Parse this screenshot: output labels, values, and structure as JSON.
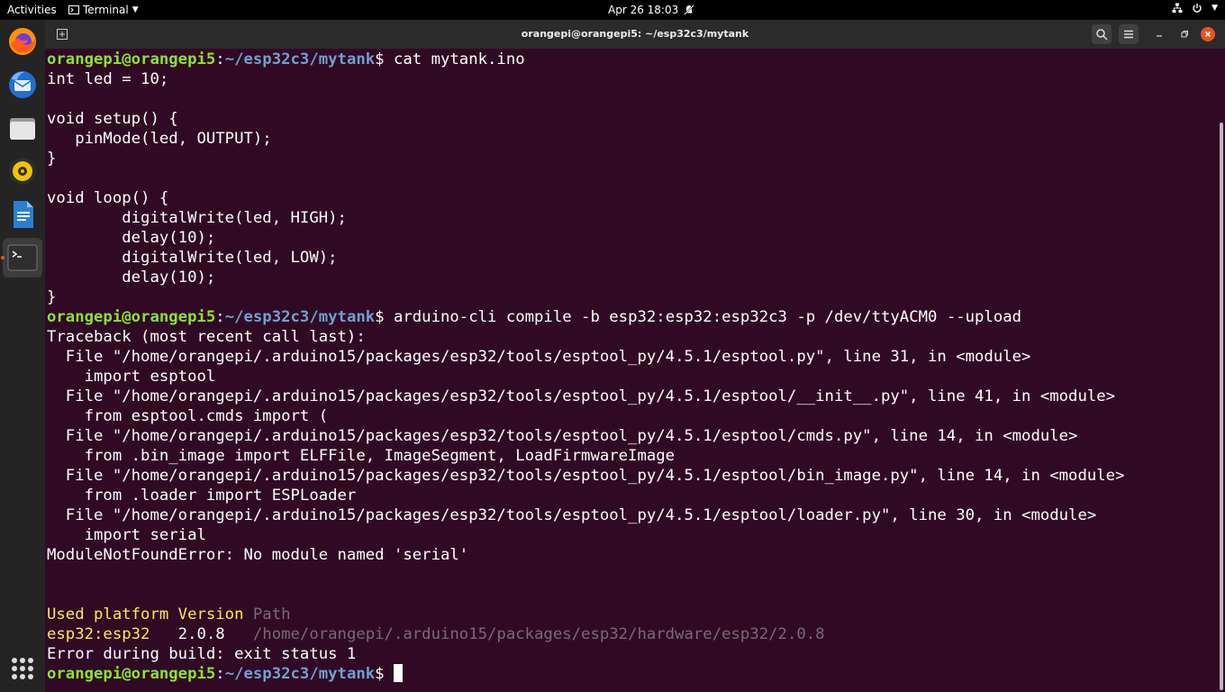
{
  "topbar": {
    "activities": "Activities",
    "app_menu": "Terminal",
    "datetime": "Apr 26  18:03"
  },
  "window": {
    "title": "orangepi@orangepi5: ~/esp32c3/mytank"
  },
  "dock": {
    "items": [
      "firefox-icon",
      "thunderbird-icon",
      "files-icon",
      "rhythmbox-icon",
      "writer-icon",
      "terminal-icon"
    ],
    "active": "terminal-icon"
  },
  "prompt": {
    "user": "orangepi@orangepi5",
    "sep": ":",
    "path": "~/esp32c3/mytank",
    "dollar": "$"
  },
  "commands": {
    "cmd1": " cat mytank.ino",
    "cmd2": " arduino-cli compile -b esp32:esp32:esp32c3 -p /dev/ttyACM0 --upload",
    "cmd3": " "
  },
  "output": {
    "code": [
      "int led = 10;",
      "",
      "void setup() {",
      "   pinMode(led, OUTPUT);",
      "}",
      "",
      "void loop() {",
      "        digitalWrite(led, HIGH);",
      "        delay(10);",
      "        digitalWrite(led, LOW);",
      "        delay(10);",
      "}"
    ],
    "traceback": [
      "Traceback (most recent call last):",
      "  File \"/home/orangepi/.arduino15/packages/esp32/tools/esptool_py/4.5.1/esptool.py\", line 31, in <module>",
      "    import esptool",
      "  File \"/home/orangepi/.arduino15/packages/esp32/tools/esptool_py/4.5.1/esptool/__init__.py\", line 41, in <module>",
      "    from esptool.cmds import (",
      "  File \"/home/orangepi/.arduino15/packages/esp32/tools/esptool_py/4.5.1/esptool/cmds.py\", line 14, in <module>",
      "    from .bin_image import ELFFile, ImageSegment, LoadFirmwareImage",
      "  File \"/home/orangepi/.arduino15/packages/esp32/tools/esptool_py/4.5.1/esptool/bin_image.py\", line 14, in <module>",
      "    from .loader import ESPLoader",
      "  File \"/home/orangepi/.arduino15/packages/esp32/tools/esptool_py/4.5.1/esptool/loader.py\", line 30, in <module>",
      "    import serial",
      "ModuleNotFoundError: No module named 'serial'"
    ],
    "platform_header": {
      "used": "Used platform Version",
      "path": " Path"
    },
    "platform_row": {
      "name": "esp32:esp32",
      "version": "   2.0.8",
      "path": "   /home/orangepi/.arduino15/packages/esp32/hardware/esp32/2.0.8"
    },
    "error": "Error during build: exit status 1"
  }
}
